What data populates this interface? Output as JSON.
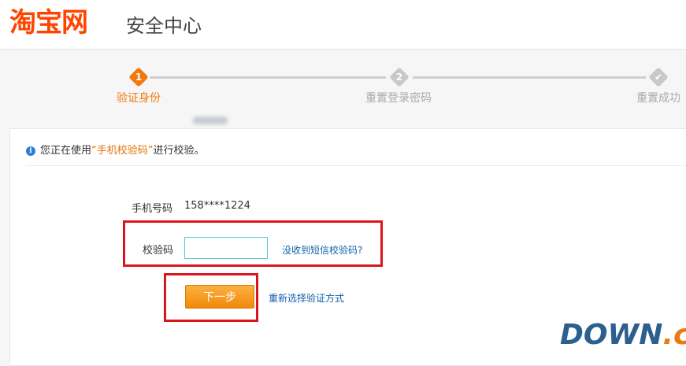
{
  "header": {
    "brand": "淘宝网",
    "subtitle": "安全中心"
  },
  "steps": [
    {
      "number": "1",
      "label": "验证身份",
      "state": "active"
    },
    {
      "number": "2",
      "label": "重置登录密码",
      "state": "pending"
    },
    {
      "number": "✔",
      "label": "重置成功",
      "state": "pending"
    }
  ],
  "notice": {
    "prefix": "您正在使用",
    "method": "“手机校验码”",
    "suffix": "进行校验。"
  },
  "form": {
    "phone_label": "手机号码",
    "phone_value": "158****1224",
    "code_label": "校验码",
    "code_placeholder": "",
    "resend_link": "没收到短信校验码?",
    "next_button": "下一步",
    "switch_link": "重新选择验证方式"
  },
  "watermark": {
    "main": "DOWN",
    "suffix": ".cc"
  },
  "colors": {
    "brand": "#ff4400",
    "active_step": "#f17a0e",
    "link": "#1060a8",
    "highlight_box": "#d9161c"
  }
}
